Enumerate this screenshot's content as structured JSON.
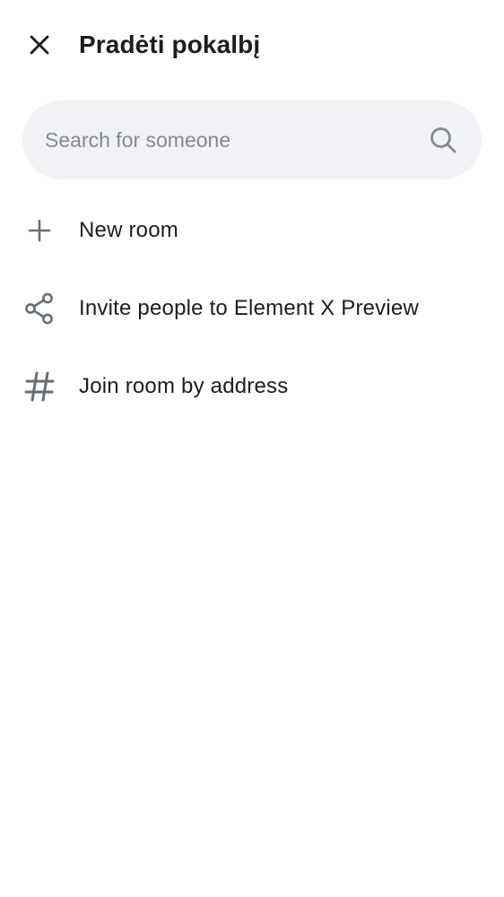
{
  "header": {
    "title": "Pradėti pokalbį",
    "close_icon": "close-icon"
  },
  "search": {
    "placeholder": "Search for someone",
    "value": "",
    "icon": "search-icon"
  },
  "menu": {
    "items": [
      {
        "label": "New room",
        "icon": "plus-icon"
      },
      {
        "label": "Invite people to Element X Preview",
        "icon": "share-icon"
      },
      {
        "label": "Join room by address",
        "icon": "hash-icon"
      }
    ]
  },
  "colors": {
    "text_primary": "#1b1d22",
    "icon_gray": "#656d77",
    "search_background": "#f0f2f5",
    "placeholder": "#818a95"
  }
}
